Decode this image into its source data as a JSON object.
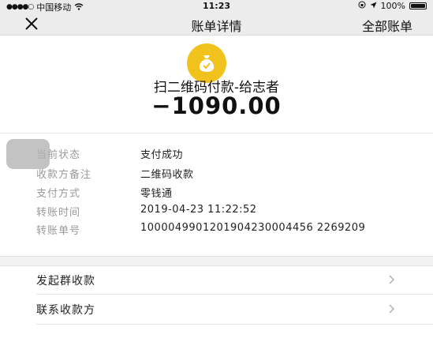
{
  "status_bar": {
    "carrier": "中国移动",
    "time": "11:23",
    "battery": "100%"
  },
  "nav": {
    "title": "账单详情",
    "action": "全部账单"
  },
  "header": {
    "merchant": "扫二维码付款-给志者",
    "amount": "−1090.00"
  },
  "details": [
    {
      "label": "当前状态",
      "value": "支付成功"
    },
    {
      "label": "收款方备注",
      "value": "二维码收款"
    },
    {
      "label": "支付方式",
      "value": "零钱通"
    },
    {
      "label": "转账时间",
      "value": "2019-04-23 11:22:52"
    },
    {
      "label": "转账单号",
      "value": "1000049901201904230004456 2269209"
    }
  ],
  "actions": [
    {
      "label": "发起群收款"
    },
    {
      "label": "联系收款方"
    }
  ],
  "colors": {
    "brand_yellow": "#f2c21c",
    "label_gray": "#9a9a9a",
    "bar_bg": "#ececec"
  },
  "icons": {
    "close": "close-icon",
    "logo": "money-bag-icon",
    "chevron": "chevron-right-icon"
  }
}
